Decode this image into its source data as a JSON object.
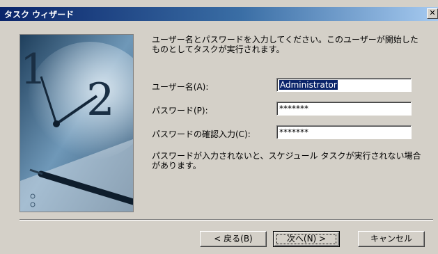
{
  "window": {
    "title": "タスク ウィザード",
    "close_glyph": "✕"
  },
  "description": "ユーザー名とパスワードを入力してください。このユーザーが開始したものとしてタスクが実行されます。",
  "fields": {
    "username": {
      "label": "ユーザー名(A):",
      "value": "Administrator"
    },
    "password": {
      "label": "パスワード(P):",
      "value": "*******"
    },
    "confirm": {
      "label": "パスワードの確認入力(C):",
      "value": "*******"
    }
  },
  "note": "パスワードが入力されないと、スケジュール タスクが実行されない場合があります。",
  "buttons": {
    "back": "< 戻る(B)",
    "next": "次へ(N) >",
    "cancel": "キャンセル"
  },
  "colors": {
    "title_start": "#0a246a",
    "title_end": "#a6caf0",
    "face": "#d4d0c8"
  },
  "icons": {
    "close": "close-icon"
  }
}
